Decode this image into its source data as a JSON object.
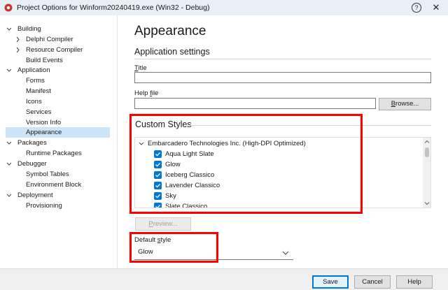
{
  "window": {
    "title": "Project Options for Winform20240419.exe  (Win32 - Debug)",
    "help_glyph": "?",
    "close_glyph": "✕"
  },
  "tree": {
    "items": [
      {
        "label": "Building",
        "level": 0,
        "expanded": true
      },
      {
        "label": "Delphi Compiler",
        "level": 1,
        "expandable": true
      },
      {
        "label": "Resource Compiler",
        "level": 1,
        "expandable": true
      },
      {
        "label": "Build Events",
        "level": 1
      },
      {
        "label": "Application",
        "level": 0,
        "expanded": true
      },
      {
        "label": "Forms",
        "level": 1
      },
      {
        "label": "Manifest",
        "level": 1
      },
      {
        "label": "Icons",
        "level": 1
      },
      {
        "label": "Services",
        "level": 1
      },
      {
        "label": "Version Info",
        "level": 1
      },
      {
        "label": "Appearance",
        "level": 1,
        "selected": true
      },
      {
        "label": "Packages",
        "level": 0,
        "expanded": true
      },
      {
        "label": "Runtime Packages",
        "level": 1
      },
      {
        "label": "Debugger",
        "level": 0,
        "expanded": true
      },
      {
        "label": "Symbol Tables",
        "level": 1
      },
      {
        "label": "Environment Block",
        "level": 1
      },
      {
        "label": "Deployment",
        "level": 0,
        "expanded": true
      },
      {
        "label": "Provisioning",
        "level": 1
      }
    ]
  },
  "page": {
    "heading": "Appearance",
    "app_settings_heading": "Application settings",
    "title_label_underlined": "T",
    "title_label_rest": "itle",
    "title_value": "",
    "helpfile_label_pre": "Help ",
    "helpfile_label_underlined": "f",
    "helpfile_label_post": "ile",
    "helpfile_value": "",
    "browse_label_underlined": "B",
    "browse_label_rest": "rowse...",
    "custom_styles_heading": "Custom Styles",
    "styles_group": "Embarcadero Technologies Inc. (High-DPI Optimized)",
    "styles": [
      {
        "label": "Aqua Light Slate",
        "checked": true
      },
      {
        "label": "Glow",
        "checked": true
      },
      {
        "label": "Iceberg Classico",
        "checked": true
      },
      {
        "label": "Lavender Classico",
        "checked": true
      },
      {
        "label": "Sky",
        "checked": true
      },
      {
        "label": "Slate Classico",
        "checked": true
      }
    ],
    "preview_label_underlined": "P",
    "preview_label_rest": "review...",
    "default_style_label_pre": "Default ",
    "default_style_label_underlined": "s",
    "default_style_label_post": "tyle",
    "default_style_value": "Glow"
  },
  "footer": {
    "save": "Save",
    "cancel": "Cancel",
    "help": "Help"
  },
  "colors": {
    "accent": "#0078d4",
    "selection": "#cce4f7",
    "annotation": "#ff0000"
  }
}
